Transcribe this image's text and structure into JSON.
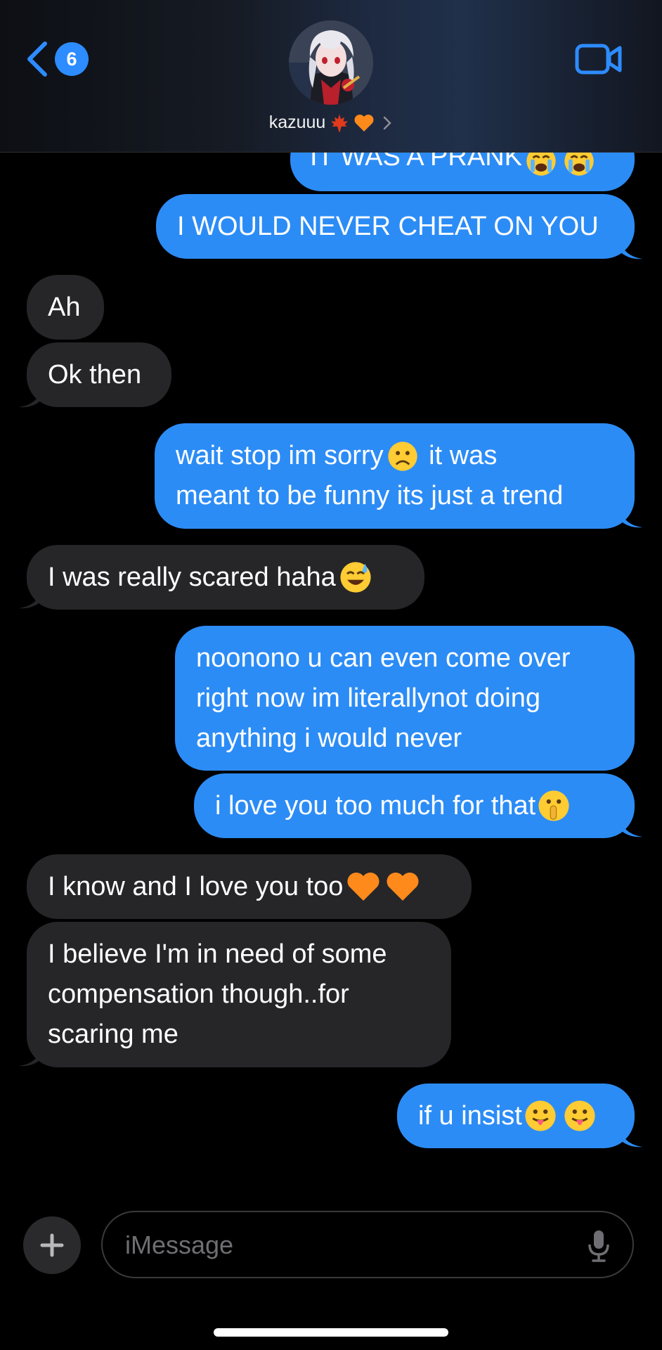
{
  "header": {
    "unread_count": "6",
    "contact_name": "kazuuu",
    "contact_emojis": [
      "maple-leaf",
      "orange-heart"
    ]
  },
  "messages": [
    {
      "from": "me",
      "text": "IT WAS A PRANK",
      "emojis": [
        "loudly-crying-face",
        "loudly-crying-face"
      ]
    },
    {
      "from": "me",
      "text": "I WOULD NEVER CHEAT ON YOU"
    },
    {
      "from": "them",
      "text": "Ah"
    },
    {
      "from": "them",
      "text": "Ok then"
    },
    {
      "from": "me",
      "text_line1": "wait stop im sorry",
      "text_line1_after": " it was",
      "text_line2": "meant to be funny its just a trend",
      "emojis": [
        "frowning-face"
      ]
    },
    {
      "from": "them",
      "text": "I was really scared haha",
      "emojis": [
        "grinning-sweat-face"
      ]
    },
    {
      "from": "me",
      "text": "noonono u can even come over\nright now im literallynot doing\nanything i would never"
    },
    {
      "from": "me",
      "text": "i love you too much for that",
      "emojis": [
        "shushing-face"
      ]
    },
    {
      "from": "them",
      "text": "I know and I love you too",
      "emojis": [
        "orange-heart",
        "orange-heart"
      ]
    },
    {
      "from": "them",
      "text": "I believe I'm in need of some\ncompensation though..for\nscaring me"
    },
    {
      "from": "me",
      "text": "if u insist",
      "emojis": [
        "tongue-face",
        "tongue-face"
      ]
    }
  ],
  "input": {
    "placeholder": "iMessage"
  },
  "colors": {
    "sent_bubble": "#2c8cf6",
    "received_bubble": "#262628",
    "accent": "#2d8cff",
    "background": "#000000"
  },
  "icons": [
    "back-chevron-icon",
    "video-camera-icon",
    "plus-icon",
    "microphone-icon",
    "chevron-right-icon"
  ]
}
